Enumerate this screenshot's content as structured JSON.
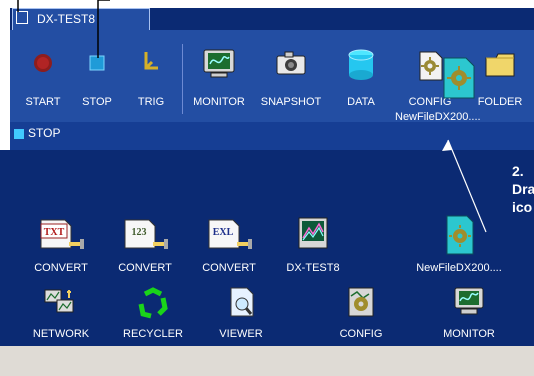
{
  "window": {
    "tab_title": "DX-TEST8",
    "status": "STOP",
    "toolbar": [
      {
        "label": "START",
        "icon": "record-icon"
      },
      {
        "label": "STOP",
        "icon": "stop-icon"
      },
      {
        "label": "TRIG",
        "icon": "trigger-icon"
      },
      {
        "label": "MONITOR",
        "icon": "monitor-icon"
      },
      {
        "label": "SNAPSHOT",
        "icon": "camera-icon"
      },
      {
        "label": "DATA",
        "icon": "database-icon"
      },
      {
        "label": "CONFIG",
        "icon": "config-file-icon"
      },
      {
        "label": "FOLDER",
        "icon": "folder-icon"
      }
    ],
    "drag_tooltip": "NewFileDX200...."
  },
  "desktop": {
    "icons": [
      {
        "label": "CONVERT",
        "icon": "txt-convert-icon",
        "badge": "TXT"
      },
      {
        "label": "CONVERT",
        "icon": "lotus-convert-icon",
        "badge": "123"
      },
      {
        "label": "CONVERT",
        "icon": "excel-convert-icon",
        "badge": "EXL"
      },
      {
        "label": "DX-TEST8",
        "icon": "chart-window-icon"
      },
      {
        "label": "NewFileDX200....",
        "icon": "config-file-icon"
      },
      {
        "label": "NETWORK",
        "icon": "network-icon"
      },
      {
        "label": "RECYCLER",
        "icon": "recycle-icon"
      },
      {
        "label": "VIEWER",
        "icon": "viewer-icon"
      },
      {
        "label": "CONFIG",
        "icon": "config-icon"
      },
      {
        "label": "MONITOR",
        "icon": "monitor-icon"
      }
    ],
    "callout": {
      "line1": "2. Dra",
      "line2": "ico"
    }
  },
  "colors": {
    "toolbar_bg": "#234ea3",
    "desktop_bg": "#0b2a73",
    "accent": "#41c9ff"
  }
}
